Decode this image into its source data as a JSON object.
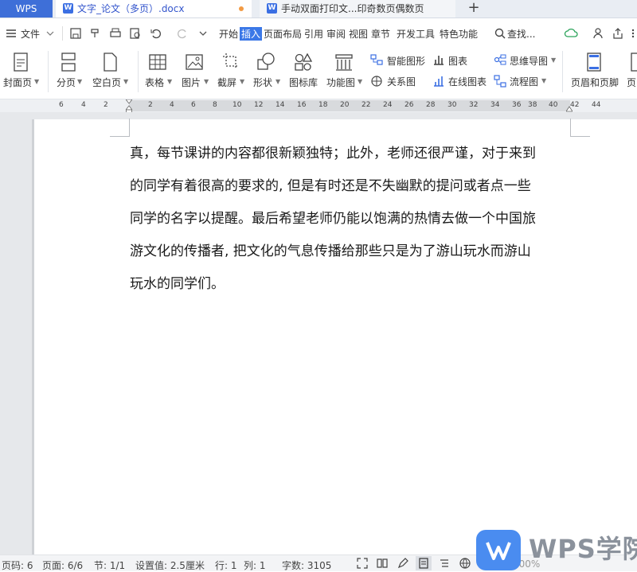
{
  "app_tab": "WPS",
  "tabs": [
    {
      "title": "文字_论文（多页）.docx"
    },
    {
      "title": "手动双面打印文...印奇数页偶数页"
    }
  ],
  "menubar": {
    "file": "文件",
    "tabs": [
      "开始",
      "插入",
      "页面布局",
      "引用",
      "审阅",
      "视图",
      "章节",
      "开发工具",
      "特色功能"
    ],
    "search": "查找..."
  },
  "ribbon": {
    "cover": "封面页",
    "page_break": "分页",
    "blank_page": "空白页",
    "table": "表格",
    "picture": "图片",
    "screenshot": "截屏",
    "shape": "形状",
    "icon_lib": "图标库",
    "func_chart": "功能图",
    "smart_shape": "智能图形",
    "chart": "图表",
    "mind_map": "思维导图",
    "relation": "关系图",
    "online_chart": "在线图表",
    "flowchart": "流程图",
    "header_footer": "页眉和页脚",
    "next": "页"
  },
  "ruler": {
    "left_numbers": [
      "6",
      "4",
      "2"
    ],
    "numbers": [
      "2",
      "4",
      "6",
      "8",
      "10",
      "12",
      "14",
      "16",
      "18",
      "20",
      "22",
      "24",
      "26",
      "28",
      "30",
      "32",
      "34",
      "36",
      "38",
      "40",
      "42",
      "44"
    ]
  },
  "document": {
    "lines": [
      "真，每节课讲的内容都很新颖独特；此外，老师还很严谨，对于来到",
      "的同学有着很高的要求的, 但是有时还是不失幽默的提问或者点一些",
      "同学的名字以提醒。最后希望老师仍能以饱满的热情去做一个中国旅",
      "游文化的传播者, 把文化的气息传播给那些只是为了游山玩水而游山",
      "玩水的同学们。"
    ]
  },
  "status": {
    "page_num": "页码: 6",
    "pages": "页面: 6/6",
    "section": "节: 1/1",
    "setting": "设置值: 2.5厘米",
    "row": "行: 1",
    "col": "列: 1",
    "words": "字数: 3105",
    "zoom": "100%"
  },
  "watermark": {
    "text": "WPS学院"
  },
  "colors": {
    "accent": "#3b78e7",
    "app_tab": "#3e6fd8",
    "modified_dot": "#f29a43"
  }
}
